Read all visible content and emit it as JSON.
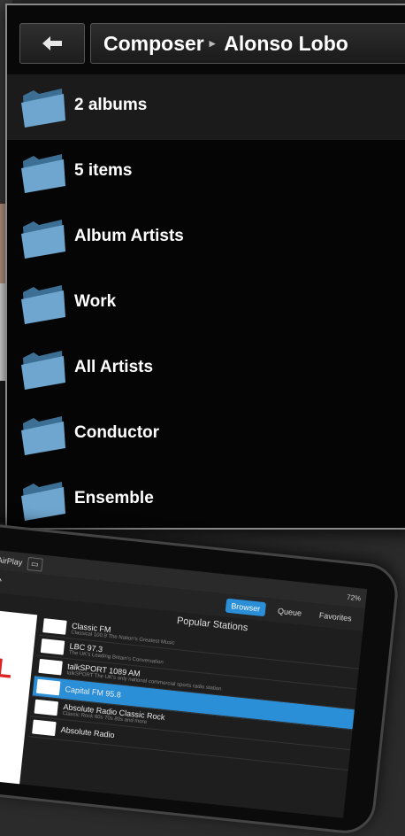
{
  "header": {
    "breadcrumb": [
      "Composer",
      "Alonso Lobo"
    ]
  },
  "folders": [
    {
      "label": "2 albums",
      "selected": true
    },
    {
      "label": "5 items",
      "selected": false
    },
    {
      "label": "Album Artists",
      "selected": false
    },
    {
      "label": "Work",
      "selected": false
    },
    {
      "label": "All Artists",
      "selected": false
    },
    {
      "label": "Conductor",
      "selected": false
    },
    {
      "label": "Ensemble",
      "selected": false
    }
  ],
  "tablet": {
    "airplay_label": "/ AirPlay",
    "status": "72%",
    "tabs": [
      "Browser",
      "Queue",
      "Favorites"
    ],
    "heading": "Popular Stations",
    "logo_text": "R\nAL",
    "stations": [
      {
        "name": "Classic FM",
        "sub": "Classical 100.9 The Nation's Greatest Music"
      },
      {
        "name": "LBC 97.3",
        "sub": "The UK's Leading Britain's Conversation"
      },
      {
        "name": "talkSPORT 1089 AM",
        "sub": "talkSPORT The UK's only national commercial sports radio station"
      },
      {
        "name": "Capital FM 95.8",
        "sub": "",
        "selected": true
      },
      {
        "name": "Absolute Radio Classic Rock",
        "sub": "Classic Rock 60s 70s 80s and more"
      },
      {
        "name": "Absolute Radio",
        "sub": ""
      }
    ]
  },
  "colors": {
    "folder": "#6fa6cf",
    "accent": "#2b8fd8"
  }
}
